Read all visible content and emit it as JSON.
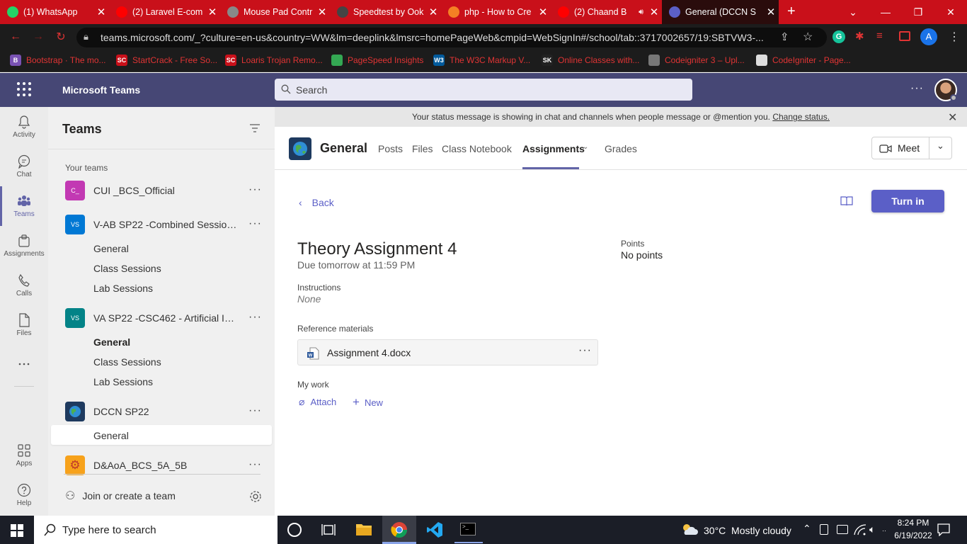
{
  "browser": {
    "tabs": [
      {
        "title": "(1) WhatsApp",
        "icon": "whatsapp-icon",
        "color": "#25d366"
      },
      {
        "title": "(2) Laravel E-com",
        "icon": "youtube-icon",
        "color": "#ff0000"
      },
      {
        "title": "Mouse Pad Contr",
        "icon": "globe-icon",
        "color": "#888888"
      },
      {
        "title": "Speedtest by Ook",
        "icon": "speedtest-icon",
        "color": "#444444"
      },
      {
        "title": "php - How to Cre",
        "icon": "stackoverflow-icon",
        "color": "#f48024"
      },
      {
        "title": "(2) Chaand B",
        "icon": "youtube-icon",
        "color": "#ff0000"
      },
      {
        "title": "General (DCCN S",
        "icon": "teams-icon",
        "color": "#5b5fc7"
      }
    ],
    "url": "teams.microsoft.com/_?culture=en-us&country=WW&lm=deeplink&lmsrc=homePageWeb&cmpid=WebSignIn#/school/tab::3717002657/19:SBTVW3-...",
    "profile_letter": "A",
    "bookmarks": [
      {
        "label": "Bootstrap · The mo...",
        "icon_text": "B",
        "color": "#7952b3"
      },
      {
        "label": "StartCrack - Free So...",
        "icon_text": "SC",
        "color": "#c9101a"
      },
      {
        "label": "Loaris Trojan Remo...",
        "icon_text": "SC",
        "color": "#c9101a"
      },
      {
        "label": "PageSpeed Insights",
        "icon_text": "",
        "color": "#34a853"
      },
      {
        "label": "The W3C Markup V...",
        "icon_text": "W3",
        "color": "#005a9c"
      },
      {
        "label": "Online Classes with...",
        "icon_text": "SK",
        "color": "#222222"
      },
      {
        "label": "Codeigniter 3 – Upl...",
        "icon_text": "",
        "color": "#777777"
      },
      {
        "label": "CodeIgniter - Page...",
        "icon_text": "",
        "color": "#dddddd"
      }
    ]
  },
  "teams": {
    "app_name": "Microsoft Teams",
    "search_placeholder": "Search",
    "rail": [
      {
        "label": "Activity",
        "icon": "bell-icon"
      },
      {
        "label": "Chat",
        "icon": "chat-icon"
      },
      {
        "label": "Teams",
        "icon": "teams-icon"
      },
      {
        "label": "Assignments",
        "icon": "assignments-icon"
      },
      {
        "label": "Calls",
        "icon": "phone-icon"
      },
      {
        "label": "Files",
        "icon": "file-icon"
      },
      {
        "label": "...",
        "icon": "more-icon"
      },
      {
        "label": "Apps",
        "icon": "apps-icon"
      },
      {
        "label": "Help",
        "icon": "help-icon"
      }
    ],
    "pane_title": "Teams",
    "your_teams_label": "Your teams",
    "team_list": [
      {
        "name": "CUI _BCS_Official",
        "avatar": "C_",
        "color": "#c239b3",
        "channels": []
      },
      {
        "name": "V-AB SP22 -Combined Session...",
        "avatar": "VS",
        "color": "#0078d4",
        "channels": [
          "General",
          "Class Sessions",
          "Lab Sessions"
        ]
      },
      {
        "name": "VA SP22 -CSC462 - Artificial Int...",
        "avatar": "VS",
        "color": "#038387",
        "channels": [
          "General",
          "Class Sessions",
          "Lab Sessions"
        ]
      },
      {
        "name": "DCCN SP22",
        "avatar": "",
        "color": "#1e3a5f",
        "channels": [
          "General"
        ]
      },
      {
        "name": "D&AoA_BCS_5A_5B",
        "avatar": "",
        "color": "#f7a21b",
        "channels": []
      }
    ],
    "join_label": "Join or create a team",
    "banner": {
      "text": "Your status message is showing in chat and channels when people message or @mention you.",
      "link": "Change status."
    },
    "channel": {
      "name": "General",
      "tabs": [
        "Posts",
        "Files",
        "Class Notebook",
        "Assignments",
        "Grades"
      ],
      "active_tab": "Assignments",
      "meet_label": "Meet"
    },
    "assignment": {
      "back_label": "Back",
      "turn_in_label": "Turn in",
      "title": "Theory Assignment 4",
      "due": "Due tomorrow at 11:59 PM",
      "points_label": "Points",
      "points_value": "No points",
      "instructions_label": "Instructions",
      "instructions_value": "None",
      "reference_label": "Reference materials",
      "file_name": "Assignment 4.docx",
      "my_work_label": "My work",
      "attach_label": "Attach",
      "new_label": "New"
    }
  },
  "taskbar": {
    "search_placeholder": "Type here to search",
    "weather": "30°C  Mostly cloudy",
    "time": "8:24 PM",
    "date": "6/19/2022"
  }
}
